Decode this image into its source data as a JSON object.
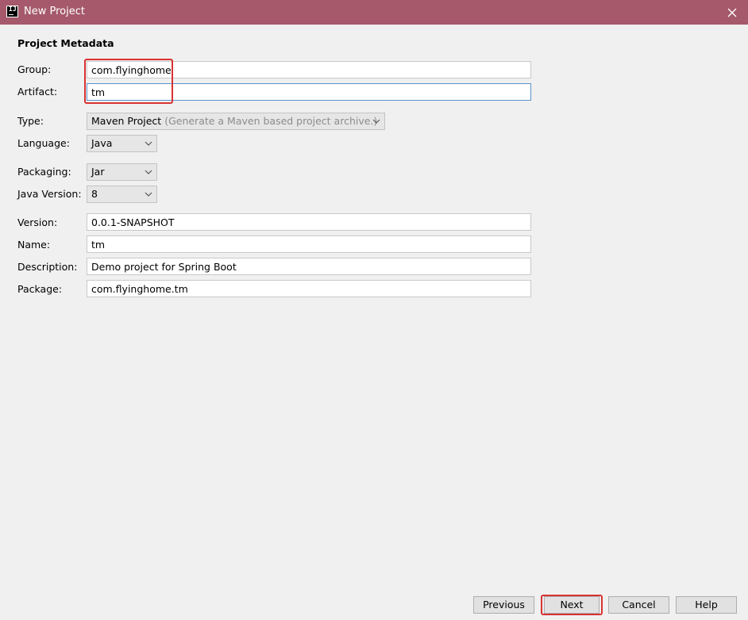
{
  "window": {
    "title": "New Project",
    "app_icon_text": "IJ",
    "close_icon": "close-icon"
  },
  "section": {
    "title": "Project Metadata"
  },
  "fields": {
    "group": {
      "label": "Group:",
      "value": "com.flyinghome"
    },
    "artifact": {
      "label": "Artifact:",
      "value": "tm"
    },
    "type": {
      "label": "Type:",
      "value": "Maven Project",
      "hint": "(Generate a Maven based project archive.)"
    },
    "language": {
      "label": "Language:",
      "value": "Java"
    },
    "packaging": {
      "label": "Packaging:",
      "value": "Jar"
    },
    "java_version": {
      "label": "Java Version:",
      "value": "8"
    },
    "version": {
      "label": "Version:",
      "value": "0.0.1-SNAPSHOT"
    },
    "name": {
      "label": "Name:",
      "value": "tm"
    },
    "description": {
      "label": "Description:",
      "value": "Demo project for Spring Boot"
    },
    "package": {
      "label": "Package:",
      "value": "com.flyinghome.tm"
    }
  },
  "buttons": {
    "previous": "Previous",
    "next": "Next",
    "cancel": "Cancel",
    "help": "Help"
  },
  "colors": {
    "titlebar": "#a5596a",
    "highlight": "#d93232",
    "focus_border": "#5a93c8"
  }
}
